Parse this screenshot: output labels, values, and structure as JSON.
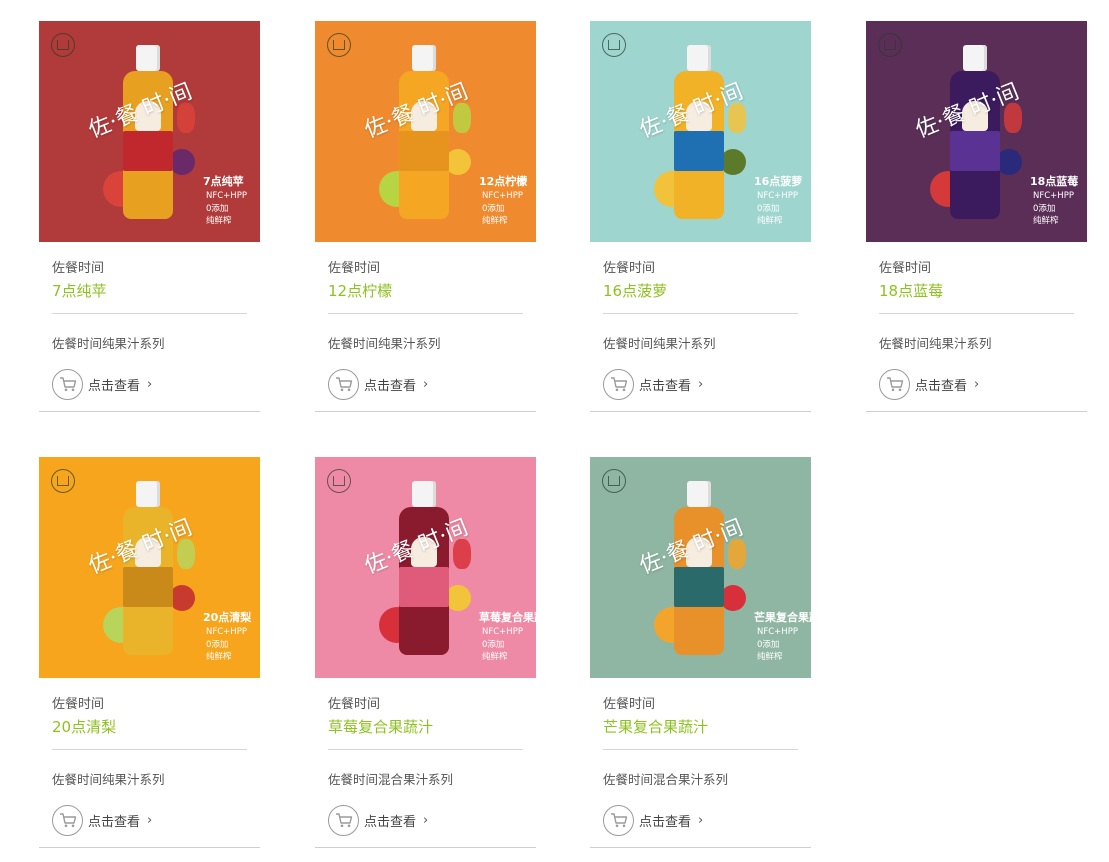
{
  "cta_label": "点击查看",
  "chevron": "›",
  "cart_icon": "shopping-cart-icon",
  "products": [
    {
      "brand": "佐餐时间",
      "name": "7点纯苹",
      "series": "佐餐时间纯果汁系列",
      "img_title": "7点纯苹",
      "img_spec": "NFC+HPP\n0添加\n纯鲜榨",
      "bg": "#b13a3a",
      "juice": "#e8a020",
      "band": "#c0282e",
      "fruit1": "#d9433a",
      "fruit2": "#6a2a6a"
    },
    {
      "brand": "佐餐时间",
      "name": "12点柠檬",
      "series": "佐餐时间纯果汁系列",
      "img_title": "12点柠檬",
      "img_spec": "NFC+HPP\n0添加\n纯鲜榨",
      "bg": "#ef8a2e",
      "juice": "#f5a623",
      "band": "#e6941e",
      "fruit1": "#b7d442",
      "fruit2": "#f3c33a"
    },
    {
      "brand": "佐餐时间",
      "name": "16点菠萝",
      "series": "佐餐时间纯果汁系列",
      "img_title": "16点菠萝",
      "img_spec": "NFC+HPP\n0添加\n纯鲜榨",
      "bg": "#9fd5cf",
      "juice": "#f2b227",
      "band": "#1f6fb3",
      "fruit1": "#f2c23a",
      "fruit2": "#5b7a2a"
    },
    {
      "brand": "佐餐时间",
      "name": "18点蓝莓",
      "series": "佐餐时间纯果汁系列",
      "img_title": "18点蓝莓",
      "img_spec": "NFC+HPP\n0添加\n纯鲜榨",
      "bg": "#5a2e57",
      "juice": "#3b1a5e",
      "band": "#5a3294",
      "fruit1": "#d43a3a",
      "fruit2": "#2b2a7a"
    },
    {
      "brand": "佐餐时间",
      "name": "20点清梨",
      "series": "佐餐时间纯果汁系列",
      "img_title": "20点清梨",
      "img_spec": "NFC+HPP\n0添加\n纯鲜榨",
      "bg": "#f6a51c",
      "juice": "#e9b32a",
      "band": "#c98a1a",
      "fruit1": "#b9d45a",
      "fruit2": "#c83a2e"
    },
    {
      "brand": "佐餐时间",
      "name": "草莓复合果蔬汁",
      "series": "佐餐时间混合果汁系列",
      "img_title": "草莓复合果蔬汁",
      "img_spec": "NFC+HPP\n0添加\n纯鲜榨",
      "bg": "#ee8aa5",
      "juice": "#8a1a2e",
      "band": "#e05a7a",
      "fruit1": "#d8303a",
      "fruit2": "#f2c43a"
    },
    {
      "brand": "佐餐时间",
      "name": "芒果复合果蔬汁",
      "series": "佐餐时间混合果汁系列",
      "img_title": "芒果复合果蔬汁",
      "img_spec": "NFC+HPP\n0添加\n纯鲜榨",
      "bg": "#8fb6a3",
      "juice": "#e8902a",
      "band": "#2a6a6a",
      "fruit1": "#f2a52a",
      "fruit2": "#d8303a"
    }
  ],
  "image_script": "佐·餐 时·间"
}
